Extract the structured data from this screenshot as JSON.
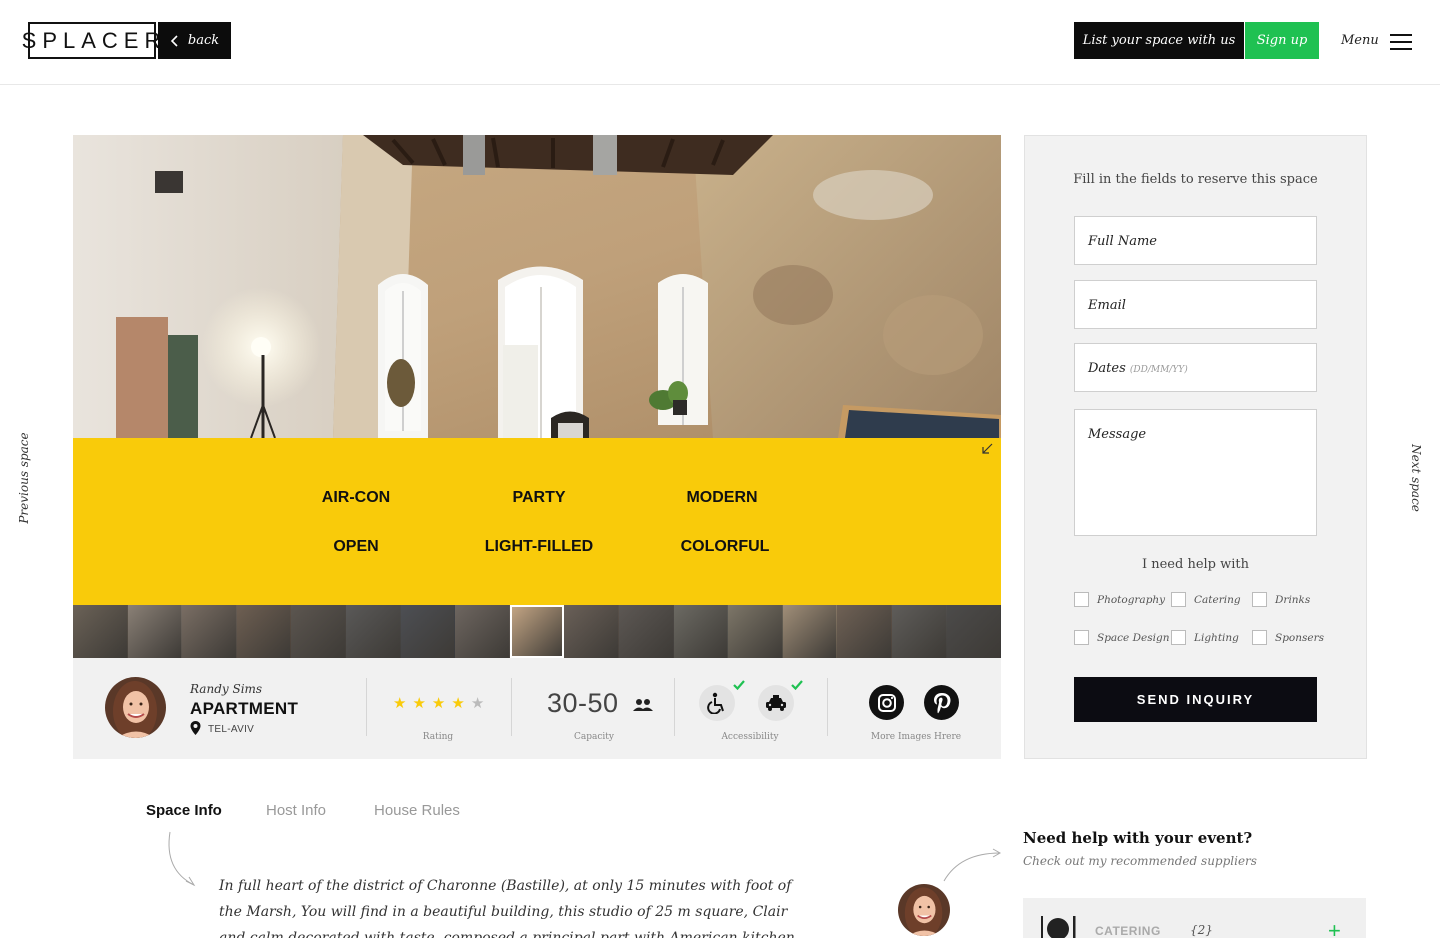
{
  "header": {
    "logo": "SPLACER",
    "back_label": "back",
    "list_space_label": "List your space with us",
    "signup_label": "Sign up",
    "menu_label": "Menu"
  },
  "side_nav": {
    "previous": "Previous space",
    "next": "Next space"
  },
  "tags": [
    "AIR-CON",
    "PARTY",
    "MODERN",
    "OPEN",
    "LIGHT-FILLED",
    "COLORFUL"
  ],
  "gallery": {
    "thumbnail_count": 17,
    "active_index": 8
  },
  "info": {
    "host_name": "Randy Sims",
    "space_type": "APARTMENT",
    "location": "TEL-AVIV",
    "rating": 4,
    "rating_max": 5,
    "rating_label": "Rating",
    "capacity": "30-50",
    "capacity_label": "Capacity",
    "accessibility_label": "Accessibility",
    "more_images_label": "More Images Hrere"
  },
  "form": {
    "title": "Fill in the fields to reserve this space",
    "full_name_placeholder": "Full Name",
    "email_placeholder": "Email",
    "dates_placeholder": "Dates",
    "dates_hint": "(DD/MM/YY)",
    "message_placeholder": "Message",
    "help_title": "I need help with",
    "help_options": [
      "Photography",
      "Catering",
      "Drinks",
      "Space Design",
      "Lighting",
      "Sponsers"
    ],
    "send_label": "SEND INQUIRY"
  },
  "tabs": [
    "Space Info",
    "Host Info",
    "House Rules"
  ],
  "description": "In full heart of the district of Charonne (Bastille), at only 15 minutes with foot of the Marsh, You will find in a beautiful building, this studio of 25 m square, Clair and calm decorated with taste, composed a principal part with American kitchen equipped and with",
  "suppliers": {
    "title": "Need help with your event?",
    "subtitle": "Check out my recommended suppliers",
    "category_label": "CATERING",
    "category_count": "{2}"
  },
  "colors": {
    "accent_yellow": "#f9cb0a",
    "signup_green": "#1fc152",
    "dark": "#0c0c0c"
  }
}
